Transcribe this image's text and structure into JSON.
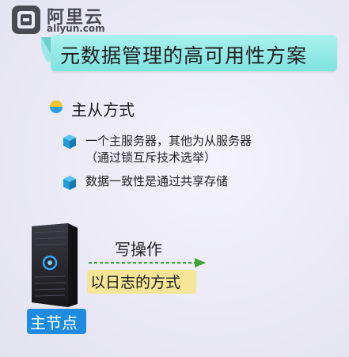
{
  "logo": {
    "cn": "阿里云",
    "en": "aliyun.com"
  },
  "title": "元数据管理的高可用性方案",
  "section": {
    "heading": "主从方式"
  },
  "bullets": [
    {
      "lines": [
        "一个主服务器，其他为从服务器",
        "（通过锁互斥技术选举）"
      ]
    },
    {
      "lines": [
        "数据一致性是通过共享存储"
      ]
    }
  ],
  "diagram": {
    "operation_label": "写操作",
    "method_label": "以日志的方式",
    "node_label": "主节点"
  },
  "icons": {
    "logo": "aliyun-logo-icon",
    "section": "pie-chart-icon",
    "bullet": "cube-icon",
    "server": "server-rack-icon",
    "arrow": "dashed-arrow-right-icon"
  },
  "colors": {
    "title_banner": "#8fe8e5",
    "bullet_cube": "#1f9bd6",
    "pie_yellow": "#f3c326",
    "pie_blue": "#2e9be6",
    "method_highlight": "#f6e497",
    "node_badge": "#1d8ce0",
    "arrow_green": "#3fa33a"
  }
}
